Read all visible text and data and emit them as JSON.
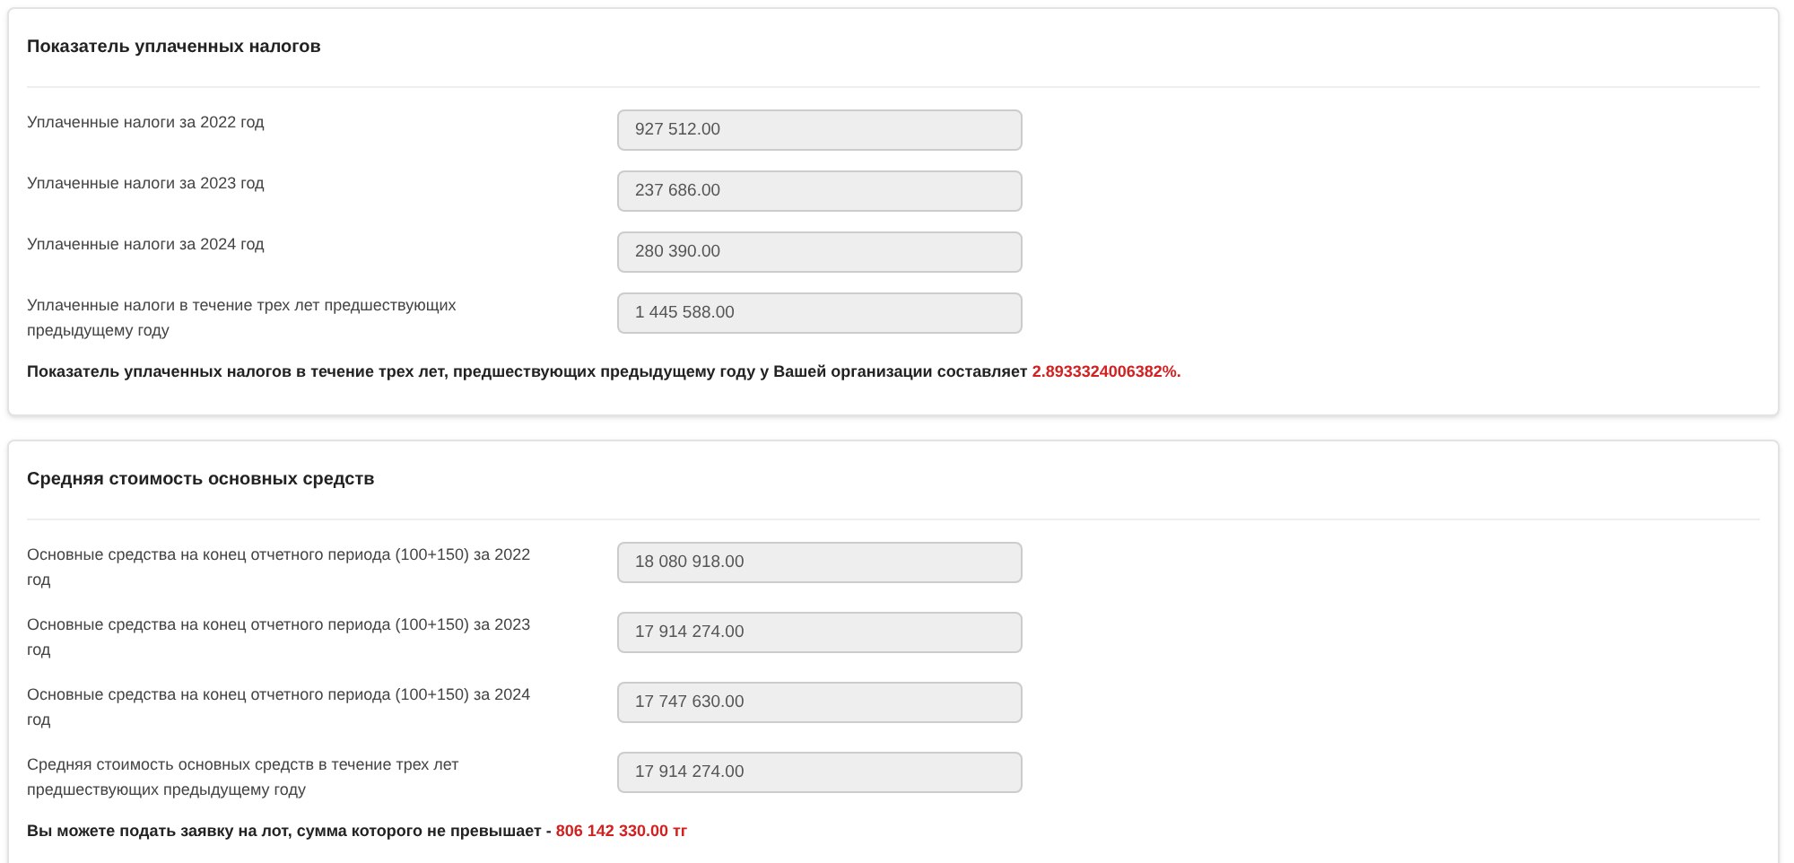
{
  "panels": [
    {
      "title": "Показатель уплаченных налогов",
      "rows": [
        {
          "label": "Уплаченные налоги за 2022 год",
          "value": "927 512.00"
        },
        {
          "label": "Уплаченные налоги за 2023 год",
          "value": "237 686.00"
        },
        {
          "label": "Уплаченные налоги за 2024 год",
          "value": "280 390.00"
        },
        {
          "label": "Уплаченные налоги в течение трех лет предшествующих предыдущему году",
          "value": "1 445 588.00"
        }
      ],
      "result": {
        "text": "Показатель уплаченных налогов в течение трех лет, предшествующих предыдущему году у Вашей организации составляет ",
        "highlight": "2.8933324006382%."
      }
    },
    {
      "title": "Средняя стоимость основных средств",
      "rows": [
        {
          "label": "Основные средства на конец отчетного периода (100+150) за 2022 год",
          "value": "18 080 918.00"
        },
        {
          "label": "Основные средства на конец отчетного периода (100+150) за 2023 год",
          "value": "17 914 274.00"
        },
        {
          "label": "Основные средства на конец отчетного периода (100+150) за 2024 год",
          "value": "17 747 630.00"
        },
        {
          "label": "Средняя стоимость основных средств в течение трех лет предшествующих предыдущему году",
          "value": "17 914 274.00"
        }
      ],
      "result": {
        "text": "Вы можете подать заявку на лот, сумма которого не превышает - ",
        "highlight": "806 142 330.00 тг"
      }
    }
  ]
}
